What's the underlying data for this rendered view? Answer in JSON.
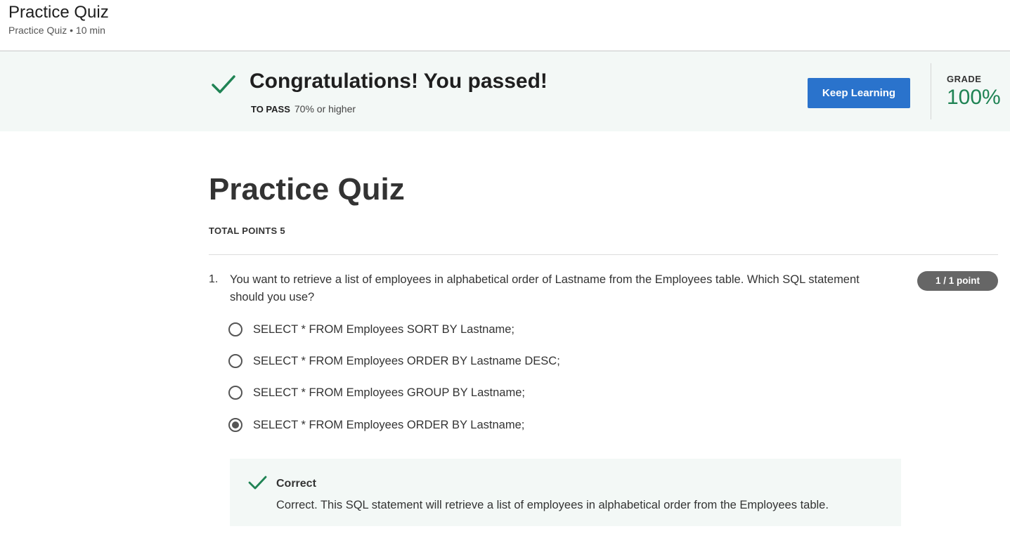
{
  "header": {
    "title": "Practice Quiz",
    "subtitle": "Practice Quiz • 10 min"
  },
  "banner": {
    "icon": "checkmark-icon",
    "title": "Congratulations! You passed!",
    "pass_label": "TO PASS",
    "pass_value": "70% or higher",
    "button_label": "Keep Learning",
    "grade_label": "GRADE",
    "grade_value": "100%"
  },
  "quiz": {
    "title": "Practice Quiz",
    "total_points": "TOTAL POINTS 5",
    "questions": [
      {
        "number": "1.",
        "text": "You want to retrieve a list of employees in alphabetical order of Lastname from the Employees table. Which SQL statement should you use?",
        "points": "1 / 1 point",
        "options": [
          {
            "label": "SELECT * FROM Employees SORT BY Lastname;",
            "selected": false
          },
          {
            "label": "SELECT * FROM Employees ORDER BY Lastname DESC;",
            "selected": false
          },
          {
            "label": "SELECT * FROM Employees GROUP BY Lastname;",
            "selected": false
          },
          {
            "label": "SELECT * FROM Employees ORDER BY Lastname;",
            "selected": true
          }
        ],
        "feedback": {
          "icon": "checkmark-icon",
          "title": "Correct",
          "text": "Correct. This SQL statement will retrieve a list of employees in alphabetical order from the Employees table."
        }
      }
    ]
  },
  "colors": {
    "accent_green": "#1f8354",
    "button_blue": "#2a73cc",
    "banner_bg": "#f3f8f6",
    "badge_gray": "#666666"
  }
}
